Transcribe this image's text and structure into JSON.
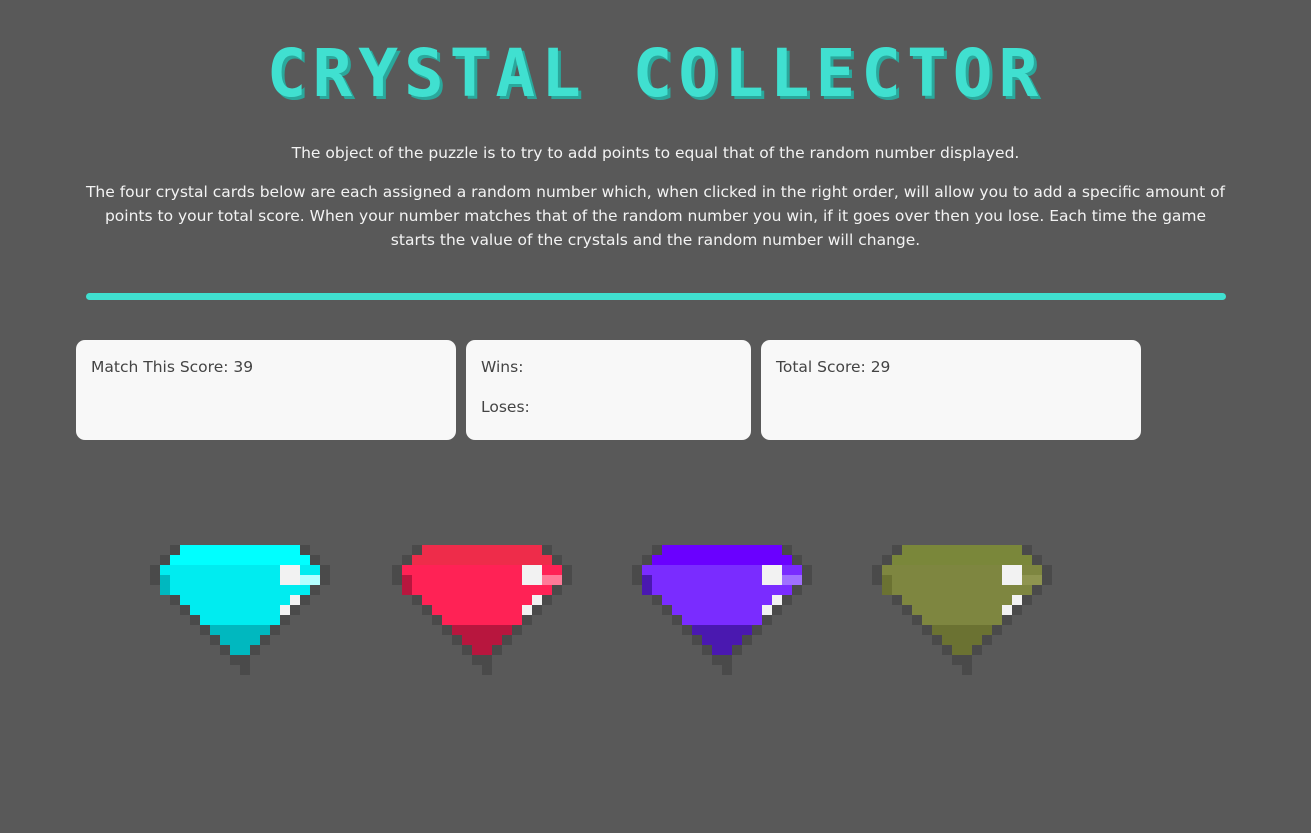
{
  "header": {
    "title": "CRYSTAL COLLECTOR"
  },
  "instructions": {
    "line1": "The object of the puzzle is to try to add points to equal that of the random number displayed.",
    "line2": "The four crystal cards below are each assigned a random number which, when clicked in the right order, will allow you to add a specific amount of points to your total score. When your number matches that of the random number you win, if it goes over then you lose. Each time the game starts the value of the crystals and the random number will change."
  },
  "scoreboard": {
    "target_text": "Match This Score: 39",
    "wins_text": "Wins:",
    "loses_text": "Loses:",
    "total_text": "Total Score: 29"
  },
  "crystals": [
    {
      "name": "cyan-crystal",
      "main": "#00ecf0",
      "light": "#00ffff",
      "dark": "#00b8bf",
      "shine": "#b3ffff"
    },
    {
      "name": "red-crystal",
      "main": "#ff2255",
      "light": "#ee2c4a",
      "dark": "#b8163e",
      "shine": "#ff7a98"
    },
    {
      "name": "purple-crystal",
      "main": "#7a2cff",
      "light": "#6a00ff",
      "dark": "#4a18b0",
      "shine": "#a070ff"
    },
    {
      "name": "olive-crystal",
      "main": "#7e8640",
      "light": "#7a873a",
      "dark": "#6b7232",
      "shine": "#8f9550"
    }
  ],
  "theme": {
    "background": "#595959",
    "accent": "#40E0D0",
    "card_bg": "#f8f8f8"
  }
}
